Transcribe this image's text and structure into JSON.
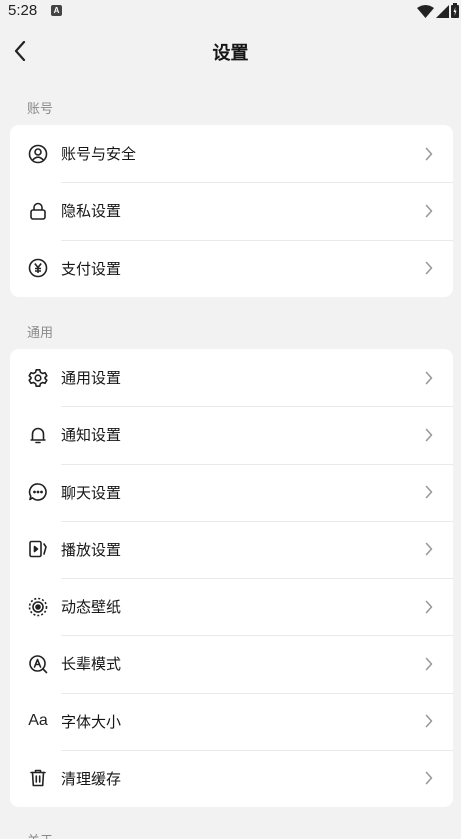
{
  "status_bar": {
    "time": "5:28",
    "notif_badge": "A"
  },
  "header": {
    "title": "设置"
  },
  "sections": [
    {
      "title": "账号",
      "items": [
        {
          "icon": "user-circle-icon",
          "label": "账号与安全"
        },
        {
          "icon": "lock-icon",
          "label": "隐私设置"
        },
        {
          "icon": "yen-circle-icon",
          "label": "支付设置"
        }
      ]
    },
    {
      "title": "通用",
      "items": [
        {
          "icon": "gear-icon",
          "label": "通用设置"
        },
        {
          "icon": "bell-icon",
          "label": "通知设置"
        },
        {
          "icon": "chat-bubble-icon",
          "label": "聊天设置"
        },
        {
          "icon": "play-device-icon",
          "label": "播放设置"
        },
        {
          "icon": "live-wallpaper-icon",
          "label": "动态壁纸"
        },
        {
          "icon": "elder-mode-icon",
          "label": "长辈模式"
        },
        {
          "icon": "font-size-icon",
          "label": "字体大小",
          "icon_text": "Aa"
        },
        {
          "icon": "trash-icon",
          "label": "清理缓存"
        }
      ]
    },
    {
      "title": "关于"
    }
  ]
}
